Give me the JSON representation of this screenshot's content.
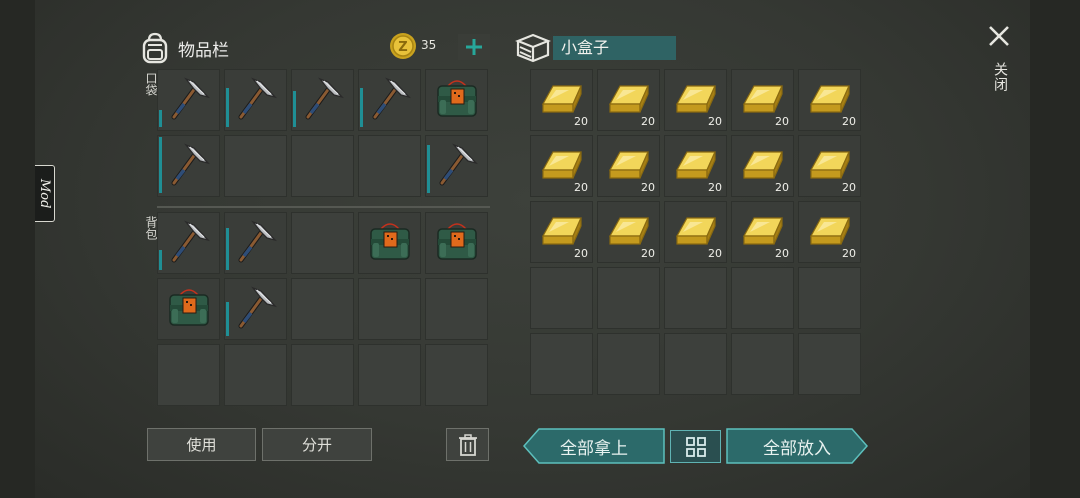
{
  "inventory": {
    "title": "物品栏",
    "currency_count": "35",
    "pocket_label": "口袋",
    "backpack_label": "背包",
    "pocket_slots": [
      {
        "item": "pickaxe",
        "durability": 0.3
      },
      {
        "item": "pickaxe",
        "durability": 0.7
      },
      {
        "item": "pickaxe",
        "durability": 0.65
      },
      {
        "item": "pickaxe",
        "durability": 0.7
      },
      {
        "item": "explosive-pack"
      },
      {
        "item": "pickaxe",
        "durability": 1.0
      },
      {
        "item": ""
      },
      {
        "item": ""
      },
      {
        "item": ""
      },
      {
        "item": "pickaxe",
        "durability": 0.85
      }
    ],
    "backpack_slots": [
      {
        "item": "pickaxe",
        "durability": 0.35
      },
      {
        "item": "pickaxe",
        "durability": 0.75
      },
      {
        "item": ""
      },
      {
        "item": "explosive-pack"
      },
      {
        "item": "explosive-pack"
      },
      {
        "item": "explosive-pack"
      },
      {
        "item": "pickaxe",
        "durability": 0.6
      },
      {
        "item": ""
      },
      {
        "item": ""
      },
      {
        "item": ""
      },
      {
        "item": ""
      },
      {
        "item": ""
      },
      {
        "item": ""
      },
      {
        "item": ""
      },
      {
        "item": ""
      }
    ],
    "use_label": "使用",
    "split_label": "分开"
  },
  "container": {
    "name": "小盒子",
    "slots": [
      {
        "item": "gold-bar",
        "count": "20"
      },
      {
        "item": "gold-bar",
        "count": "20"
      },
      {
        "item": "gold-bar",
        "count": "20"
      },
      {
        "item": "gold-bar",
        "count": "20"
      },
      {
        "item": "gold-bar",
        "count": "20"
      },
      {
        "item": "gold-bar",
        "count": "20"
      },
      {
        "item": "gold-bar",
        "count": "20"
      },
      {
        "item": "gold-bar",
        "count": "20"
      },
      {
        "item": "gold-bar",
        "count": "20"
      },
      {
        "item": "gold-bar",
        "count": "20"
      },
      {
        "item": "gold-bar",
        "count": "20"
      },
      {
        "item": "gold-bar",
        "count": "20"
      },
      {
        "item": "gold-bar",
        "count": "20"
      },
      {
        "item": "gold-bar",
        "count": "20"
      },
      {
        "item": "gold-bar",
        "count": "20"
      },
      {
        "item": ""
      },
      {
        "item": ""
      },
      {
        "item": ""
      },
      {
        "item": ""
      },
      {
        "item": ""
      },
      {
        "item": ""
      },
      {
        "item": ""
      },
      {
        "item": ""
      },
      {
        "item": ""
      },
      {
        "item": ""
      }
    ],
    "take_all_label": "全部拿上",
    "put_all_label": "全部放入"
  },
  "close_label": "关闭",
  "mod_label": "Mod",
  "colors": {
    "accent": "#2f6364",
    "teal": "#1f8f95",
    "gold": "#d9b72b"
  }
}
